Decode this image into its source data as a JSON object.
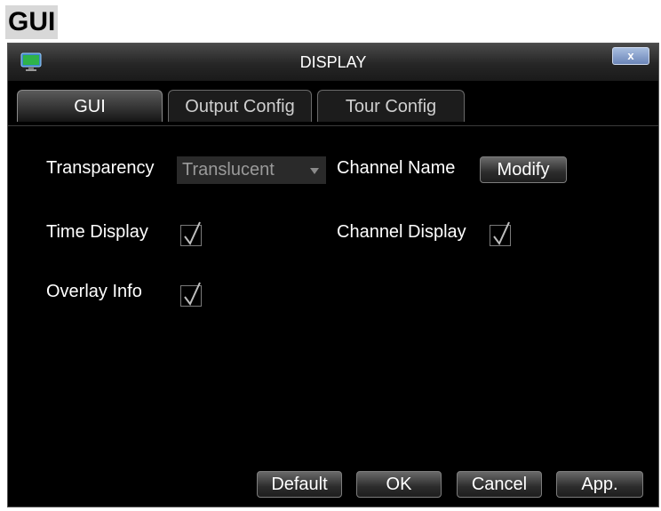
{
  "heading": "GUI",
  "window": {
    "title": "DISPLAY",
    "close_label": "x"
  },
  "tabs": [
    {
      "label": "GUI",
      "active": true
    },
    {
      "label": "Output Config",
      "active": false
    },
    {
      "label": "Tour Config",
      "active": false
    }
  ],
  "form": {
    "transparency": {
      "label": "Transparency",
      "value": "Translucent"
    },
    "channel_name": {
      "label": "Channel Name",
      "button": "Modify"
    },
    "time_display": {
      "label": "Time Display",
      "checked": true
    },
    "channel_display": {
      "label": "Channel Display",
      "checked": true
    },
    "overlay_info": {
      "label": "Overlay Info",
      "checked": true
    }
  },
  "buttons": {
    "default": "Default",
    "ok": "OK",
    "cancel": "Cancel",
    "apply": "App."
  },
  "icons": {
    "window": "monitor-icon",
    "close": "close-icon",
    "dropdown": "chevron-down-icon",
    "check": "check-icon"
  }
}
